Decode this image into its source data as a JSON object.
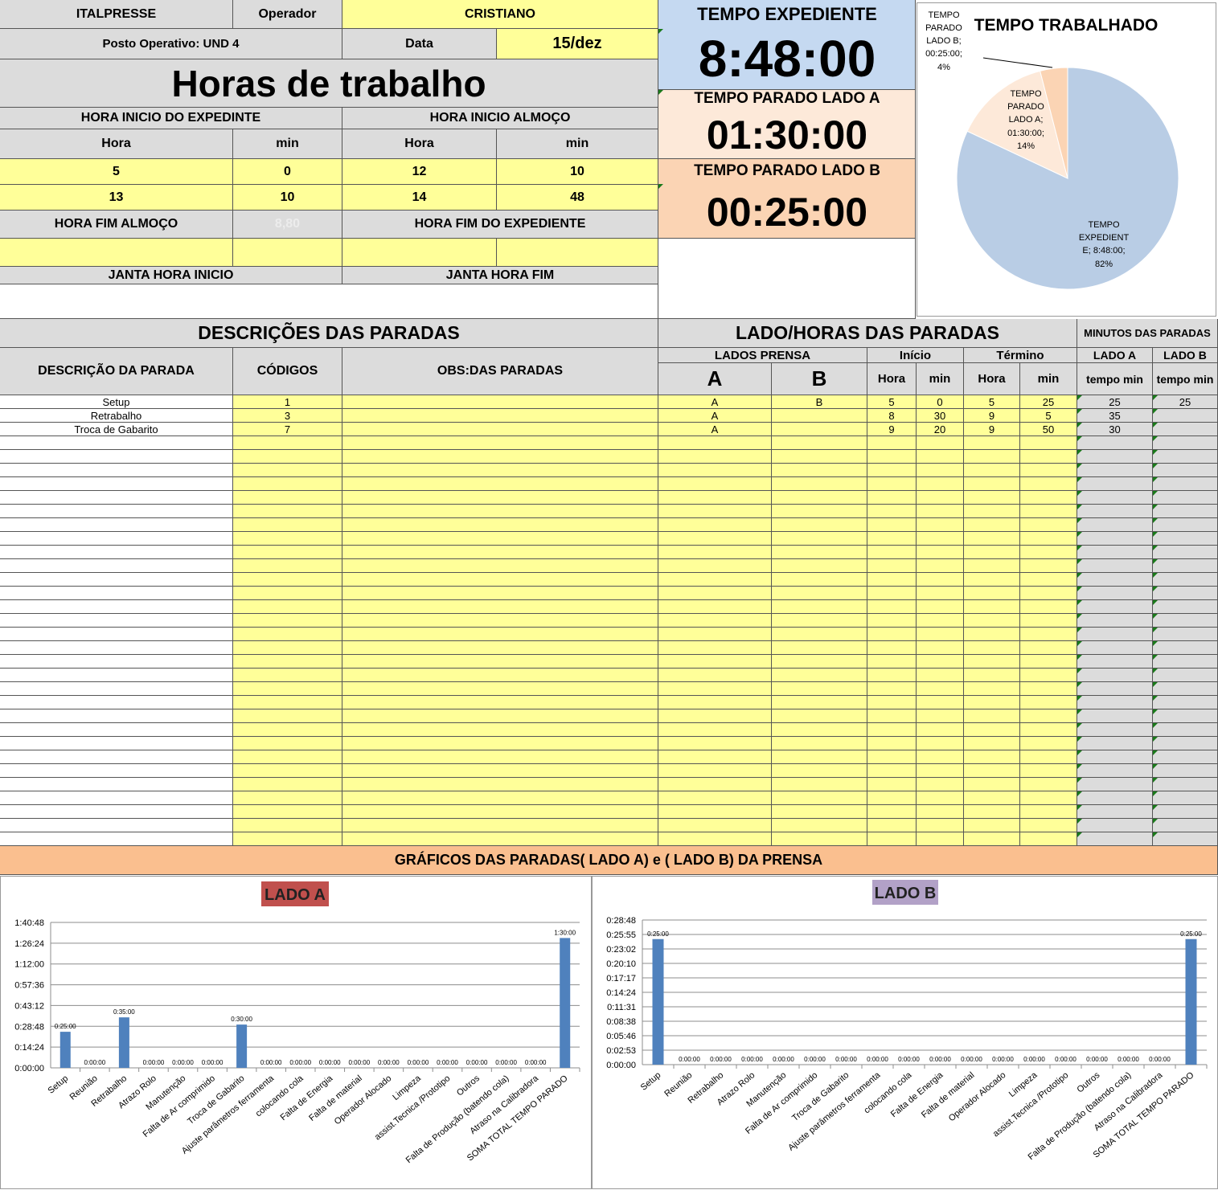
{
  "header": {
    "company": "ITALPRESSE",
    "operator_label": "Operador",
    "operator_value": "CRISTIANO",
    "post_label": "Posto Operativo: UND 4",
    "date_label": "Data",
    "date_value": "15/dez",
    "title": "Horas de trabalho"
  },
  "hours": {
    "start_shift_label": "HORA INICIO DO EXPEDINTE",
    "start_lunch_label": "HORA INICIO ALMOÇO",
    "hora_label": "Hora",
    "min_label": "min",
    "row1": [
      "5",
      "0",
      "12",
      "10"
    ],
    "row2": [
      "13",
      "10",
      "14",
      "48"
    ],
    "end_lunch_label": "HORA FIM ALMOÇO",
    "faded_value": "8,80",
    "end_shift_label": "HORA FIM DO EXPEDIENTE",
    "dinner_start_label": "JANTA HORA INICIO",
    "dinner_end_label": "JANTA HORA FIM"
  },
  "totals": {
    "expediente_label": "TEMPO EXPEDIENTE",
    "expediente_value": "8:48:00",
    "lado_a_label": "TEMPO PARADO LADO A",
    "lado_a_value": "01:30:00",
    "lado_b_label": "TEMPO PARADO LADO B",
    "lado_b_value": "00:25:00",
    "colors": {
      "expediente": "#c5d9f1",
      "lado_a": "#fde9d9",
      "lado_b": "#fbd4b4"
    }
  },
  "pie": {
    "title": "TEMPO TRABALHADO",
    "label_b": [
      "TEMPO",
      "PARADO",
      "LADO B;",
      "00:25:00;",
      "4%"
    ],
    "label_a": [
      "TEMPO",
      "PARADO",
      "LADO A;",
      "01:30:00;",
      "14%"
    ],
    "label_exp": [
      "TEMPO",
      "EXPEDIENT",
      "E; 8:48:00;",
      "82%"
    ]
  },
  "stops": {
    "desc_title": "DESCRIÇÕES DAS PARADAS",
    "lado_title": "LADO/HORAS DAS PARADAS",
    "minutos_title": "MINUTOS DAS PARADAS",
    "desc_col": "DESCRIÇÃO DA PARADA",
    "codes_col": "CÓDIGOS",
    "obs_col": "OBS:DAS PARADAS",
    "lados_prensa": "LADOS PRENSA",
    "inicio": "Início",
    "termino": "Término",
    "lado_a_col": "LADO A",
    "lado_b_col": "LADO B",
    "a": "A",
    "b": "B",
    "hora": "Hora",
    "min": "min",
    "tempo_min": "tempo min",
    "rows": [
      [
        "Setup",
        "1",
        "",
        "A",
        "B",
        "5",
        "0",
        "5",
        "25",
        "25",
        "25"
      ],
      [
        "Retrabalho",
        "3",
        "",
        "A",
        "",
        "8",
        "30",
        "9",
        "5",
        "35",
        ""
      ],
      [
        "Troca de Gabarito",
        "7",
        "",
        "A",
        "",
        "9",
        "20",
        "9",
        "50",
        "30",
        ""
      ]
    ]
  },
  "charts_banner": "GRÁFICOS DAS PARADAS( LADO A) e ( LADO B) DA PRENSA",
  "chart_data": [
    {
      "type": "bar",
      "title": "LADO A",
      "categories": [
        "Setup",
        "Reunião",
        "Retrabalho",
        "Atrazo Rolo",
        "Manutenção",
        "Falta de Ar comprimido",
        "Troca de Gabarito",
        "Ajuste parâmetros ferramenta",
        "colocando cola",
        "Falta de Energia",
        "Falta de material",
        "Operador Alocado",
        "Limpeza",
        "assist.Tecnica /Prototipo",
        "Outros",
        "Falta de Produção (batendo cola)",
        "Atraso na Calibradora",
        "SOMA TOTAL TEMPO PARADO"
      ],
      "values_min": [
        25,
        0,
        35,
        0,
        0,
        0,
        30,
        0,
        0,
        0,
        0,
        0,
        0,
        0,
        0,
        0,
        0,
        90
      ],
      "data_labels": [
        "0:25:00",
        "0:00:00",
        "0:35:00",
        "0:00:00",
        "0:00:00",
        "0:00:00",
        "0:30:00",
        "0:00:00",
        "0:00:00",
        "0:00:00",
        "0:00:00",
        "0:00:00",
        "0:00:00",
        "0:00:00",
        "0:00:00",
        "0:00:00",
        "0:00:00",
        "1:30:00"
      ],
      "y_ticks": [
        "0:00:00",
        "0:14:24",
        "0:28:48",
        "0:43:12",
        "0:57:36",
        "1:12:00",
        "1:26:24",
        "1:40:48"
      ],
      "ylim_min": [
        0,
        100.8
      ],
      "bar_color": "#4f81bd",
      "title_bg": "#c0504d"
    },
    {
      "type": "bar",
      "title": "LADO B",
      "categories": [
        "Setup",
        "Reunião",
        "Retrabalho",
        "Atrazo Rolo",
        "Manutenção",
        "Falta de Ar comprimido",
        "Troca de Gabarito",
        "Ajuste parâmetros ferramenta",
        "colocando cola",
        "Falta de Energia",
        "Falta de material",
        "Operador Alocado",
        "Limpeza",
        "assist.Tecnica /Prototipo",
        "Outros",
        "Falta de Produção (batendo cola)",
        "Atraso na Calibradora",
        "SOMA TOTAL TEMPO PARADO"
      ],
      "values_min": [
        25,
        0,
        0,
        0,
        0,
        0,
        0,
        0,
        0,
        0,
        0,
        0,
        0,
        0,
        0,
        0,
        0,
        25
      ],
      "data_labels": [
        "0:25:00",
        "0:00:00",
        "0:00:00",
        "0:00:00",
        "0:00:00",
        "0:00:00",
        "0:00:00",
        "0:00:00",
        "0:00:00",
        "0:00:00",
        "0:00:00",
        "0:00:00",
        "0:00:00",
        "0:00:00",
        "0:00:00",
        "0:00:00",
        "0:00:00",
        "0:25:00"
      ],
      "y_ticks": [
        "0:00:00",
        "0:02:53",
        "0:05:46",
        "0:08:38",
        "0:11:31",
        "0:14:24",
        "0:17:17",
        "0:20:10",
        "0:23:02",
        "0:25:55",
        "0:28:48"
      ],
      "ylim_min": [
        0,
        28.8
      ],
      "bar_color": "#4f81bd",
      "title_bg": "#b2a1c7"
    },
    {
      "type": "pie",
      "title": "TEMPO TRABALHADO",
      "slices": [
        {
          "label": "TEMPO EXPEDIENTE",
          "value": "8:48:00",
          "percent": 82,
          "color": "#b9cde5"
        },
        {
          "label": "TEMPO PARADO LADO A",
          "value": "01:30:00",
          "percent": 14,
          "color": "#fde9d9"
        },
        {
          "label": "TEMPO PARADO LADO B",
          "value": "00:25:00",
          "percent": 4,
          "color": "#fbd4b4"
        }
      ]
    }
  ]
}
